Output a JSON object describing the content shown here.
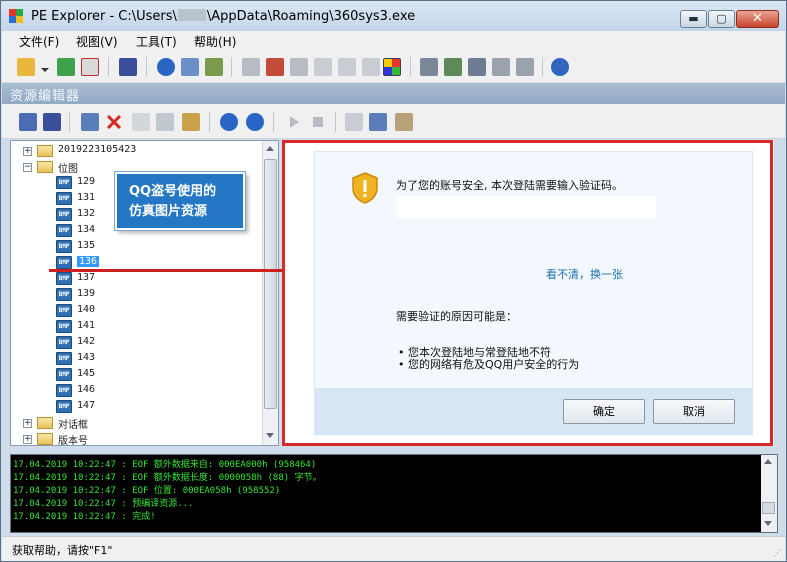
{
  "window": {
    "title_prefix": "PE Explorer - C:\\Users\\",
    "title_suffix": "\\AppData\\Roaming\\360sys3.exe",
    "min_glyph": "▬",
    "max_glyph": "▢",
    "close_glyph": "✕"
  },
  "menu": [
    {
      "label": "文件(F)"
    },
    {
      "label": "视图(V)"
    },
    {
      "label": "工具(T)"
    },
    {
      "label": "帮助(H)"
    }
  ],
  "panel_header": "资源编辑器",
  "tree": {
    "root": "2019223105423",
    "bitmap_folder": "位图",
    "bitmaps": [
      "129",
      "131",
      "132",
      "134",
      "135",
      "136",
      "137",
      "139",
      "140",
      "141",
      "142",
      "143",
      "145",
      "146",
      "147"
    ],
    "selected": "136",
    "dialog_folder": "对话框",
    "version_folder": "版本号"
  },
  "callout": {
    "line1": "QQ盗号使用的",
    "line2": "仿真图片资源"
  },
  "dialog": {
    "prompt": "为了您的账号安全, 本次登陆需要输入验证码。",
    "refresh_link": "看不清，换一张",
    "reason_title": "需要验证的原因可能是：",
    "reason_1": "• 您本次登陆地与常登陆地不符",
    "reason_2": "• 您的网络有危及QQ用户安全的行为",
    "ok_label": "确定",
    "cancel_label": "取消"
  },
  "log": [
    "17.04.2019 10:22:47 : EOF 额外数据来自: 000EA000h  (958464)",
    "17.04.2019 10:22:47 : EOF 额外数据长度: 0000058h  (88) 字节。",
    "17.04.2019 10:22:47 : EOF 位置: 000EA058h  (958552)",
    "17.04.2019 10:22:47 : 预编译资源...",
    "17.04.2019 10:22:47 : 完成!"
  ],
  "status": "获取帮助，请按\"F1\"",
  "colors": {
    "accent_red": "#d62a2a",
    "selection_blue": "#3399ff",
    "log_green": "#35e535",
    "callout_blue": "#2477c4"
  },
  "icons": {
    "toolbar_main": [
      "open-folder-icon",
      "dropdown-arrow-icon",
      "refresh-icon",
      "close-file-icon",
      "save-icon",
      "info-icon",
      "headers-icon",
      "sections-icon",
      "import-icon",
      "export-icon",
      "resources-icon",
      "debug-icon",
      "disassemble-icon",
      "dependency-icon",
      "resource-editor-icon",
      "tools-icon",
      "tree-icon",
      "plugins-icon",
      "settings-icon",
      "help-icon"
    ],
    "toolbar_resource": [
      "copy-icon",
      "save-resource-icon",
      "edit-icon",
      "delete-icon",
      "undo-icon",
      "duplicate-icon",
      "replace-icon",
      "move-down-icon",
      "move-up-icon",
      "play-icon",
      "stop-icon",
      "dialog-edit-icon",
      "properties-icon",
      "view-icon"
    ]
  }
}
